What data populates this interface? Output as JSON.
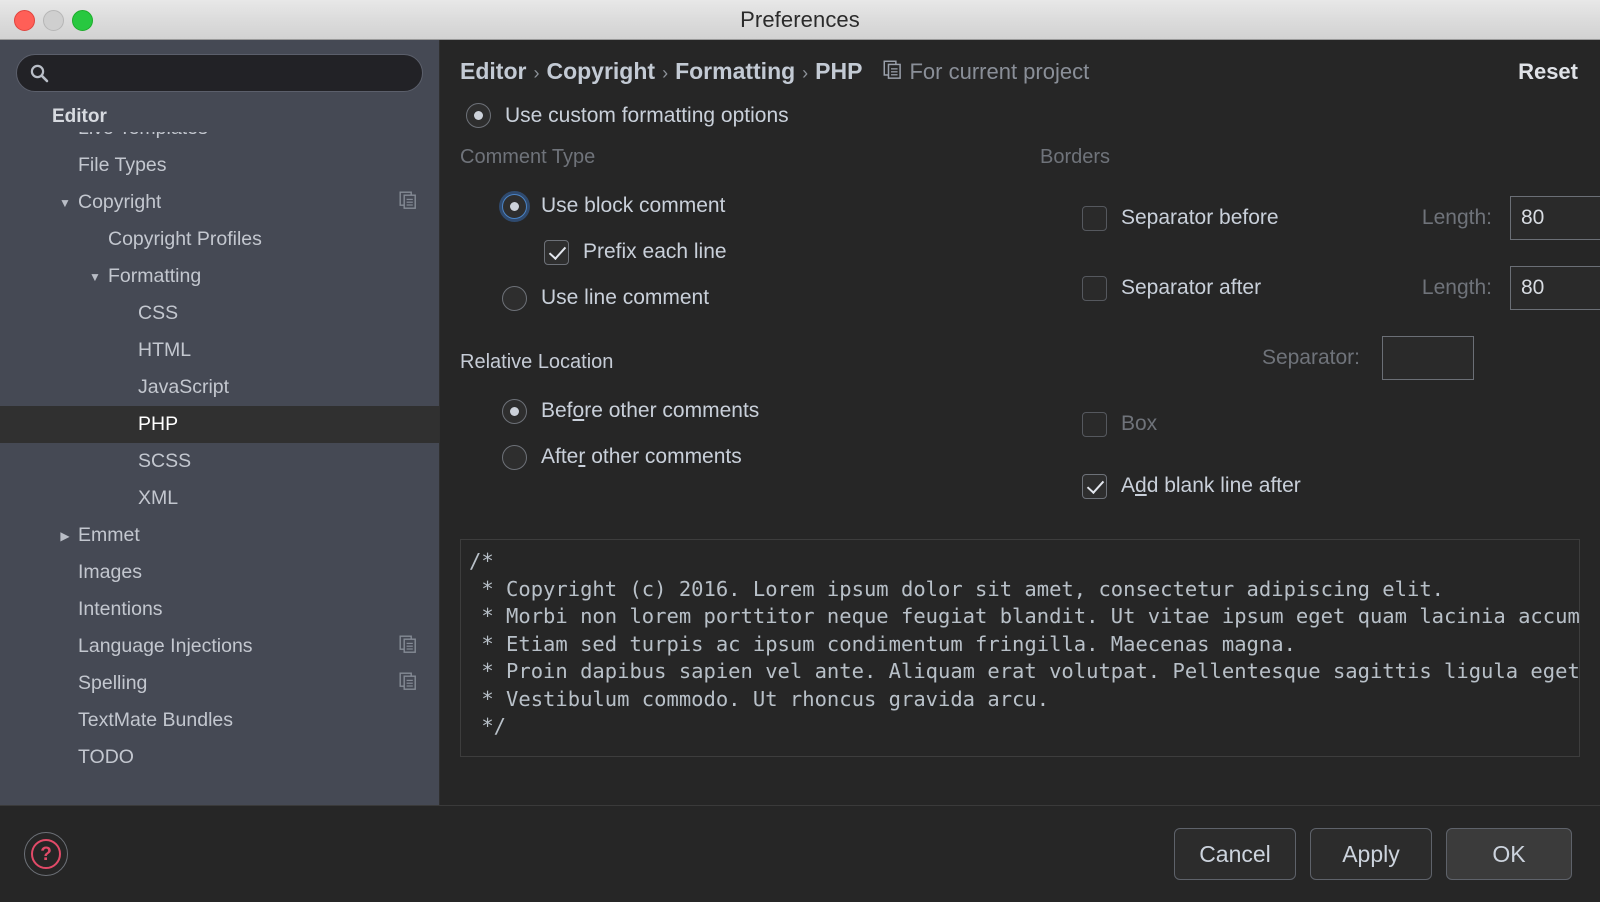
{
  "window": {
    "title": "Preferences",
    "traffic_lights": [
      "close",
      "minimize",
      "maximize"
    ]
  },
  "sidebar": {
    "search": {
      "value": "",
      "placeholder": ""
    },
    "sticky_header": "Editor",
    "items": [
      {
        "label": "Live Templates",
        "indent": 1,
        "twisty": "",
        "selected": false,
        "scope_icon": false
      },
      {
        "label": "File Types",
        "indent": 1,
        "twisty": "",
        "selected": false,
        "scope_icon": false
      },
      {
        "label": "Copyright",
        "indent": 1,
        "twisty": "▼",
        "selected": false,
        "scope_icon": true
      },
      {
        "label": "Copyright Profiles",
        "indent": 2,
        "twisty": "",
        "selected": false,
        "scope_icon": false
      },
      {
        "label": "Formatting",
        "indent": 2,
        "twisty": "▼",
        "selected": false,
        "scope_icon": false
      },
      {
        "label": "CSS",
        "indent": 3,
        "twisty": "",
        "selected": false,
        "scope_icon": false
      },
      {
        "label": "HTML",
        "indent": 3,
        "twisty": "",
        "selected": false,
        "scope_icon": false
      },
      {
        "label": "JavaScript",
        "indent": 3,
        "twisty": "",
        "selected": false,
        "scope_icon": false
      },
      {
        "label": "PHP",
        "indent": 3,
        "twisty": "",
        "selected": true,
        "scope_icon": false
      },
      {
        "label": "SCSS",
        "indent": 3,
        "twisty": "",
        "selected": false,
        "scope_icon": false
      },
      {
        "label": "XML",
        "indent": 3,
        "twisty": "",
        "selected": false,
        "scope_icon": false
      },
      {
        "label": "Emmet",
        "indent": 1,
        "twisty": "▶",
        "selected": false,
        "scope_icon": false
      },
      {
        "label": "Images",
        "indent": 1,
        "twisty": "",
        "selected": false,
        "scope_icon": false
      },
      {
        "label": "Intentions",
        "indent": 1,
        "twisty": "",
        "selected": false,
        "scope_icon": false
      },
      {
        "label": "Language Injections",
        "indent": 1,
        "twisty": "",
        "selected": false,
        "scope_icon": true
      },
      {
        "label": "Spelling",
        "indent": 1,
        "twisty": "",
        "selected": false,
        "scope_icon": true
      },
      {
        "label": "TextMate Bundles",
        "indent": 1,
        "twisty": "",
        "selected": false,
        "scope_icon": false
      },
      {
        "label": "TODO",
        "indent": 1,
        "twisty": "",
        "selected": false,
        "scope_icon": false
      }
    ]
  },
  "header": {
    "breadcrumbs": [
      "Editor",
      "Copyright",
      "Formatting",
      "PHP"
    ],
    "separator": "›",
    "scope_label": "For current project",
    "scope_icon": "copy-icon",
    "reset_label": "Reset"
  },
  "main": {
    "custom_formatting": {
      "label": "Use custom formatting options",
      "checked": true
    },
    "comment_type": {
      "title": "Comment Type",
      "block": {
        "label": "Use block comment",
        "checked": true,
        "focused": true
      },
      "prefix_each_line": {
        "label": "Prefix each line",
        "checked": true
      },
      "line": {
        "label": "Use line comment",
        "checked": false
      }
    },
    "relative_location": {
      "title": "Relative Location",
      "before": {
        "label": "Before other comments",
        "checked": true,
        "mnemonic": "o"
      },
      "after": {
        "label": "After other comments",
        "checked": false,
        "mnemonic": "r"
      }
    },
    "borders": {
      "title": "Borders",
      "separator_before": {
        "label": "Separator before",
        "checked": false,
        "length_label": "Length:",
        "length_value": "80"
      },
      "separator_after": {
        "label": "Separator after",
        "checked": false,
        "length_label": "Length:",
        "length_value": "80"
      },
      "separator": {
        "label": "Separator:",
        "value": ""
      },
      "box": {
        "label": "Box",
        "checked": false
      },
      "add_blank_line_after": {
        "label": "Add blank line after",
        "checked": true,
        "mnemonic": "d"
      }
    },
    "preview": {
      "lines": [
        "/*",
        " * Copyright (c) 2016. Lorem ipsum dolor sit amet, consectetur adipiscing elit.",
        " * Morbi non lorem porttitor neque feugiat blandit. Ut vitae ipsum eget quam lacinia accumsan.",
        " * Etiam sed turpis ac ipsum condimentum fringilla. Maecenas magna.",
        " * Proin dapibus sapien vel ante. Aliquam erat volutpat. Pellentesque sagittis ligula eget metus.",
        " * Vestibulum commodo. Ut rhoncus gravida arcu.",
        " */"
      ]
    }
  },
  "footer": {
    "help_label": "?",
    "buttons": [
      {
        "label": "Cancel",
        "default": false
      },
      {
        "label": "Apply",
        "default": false
      },
      {
        "label": "OK",
        "default": true
      }
    ]
  },
  "colors": {
    "sidebar_bg": "#454954",
    "content_bg": "#262626",
    "selected_row": "#303030",
    "accent_focus": "#4b83c4",
    "help_accent": "#e24a68",
    "text_primary": "#c9d0da",
    "text_dim": "#6f737a"
  }
}
